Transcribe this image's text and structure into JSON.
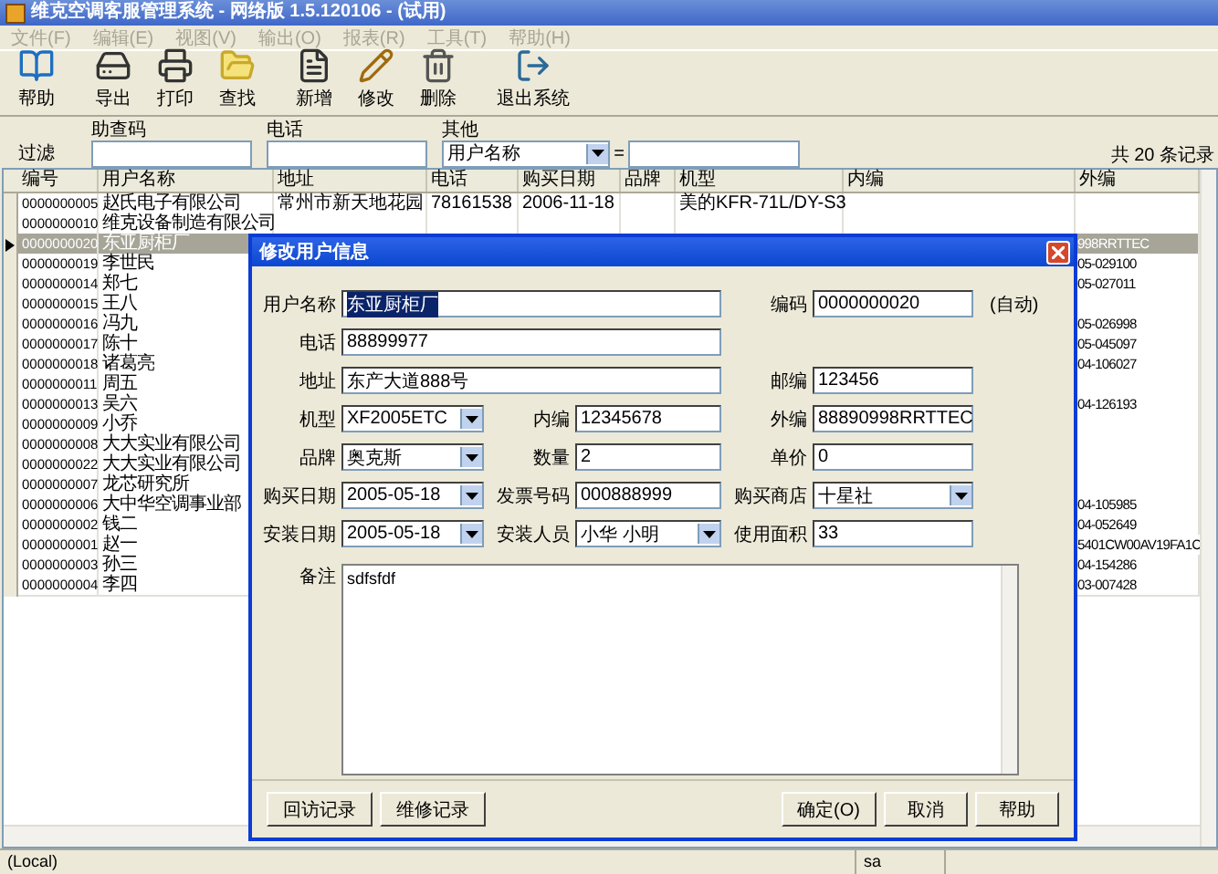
{
  "window": {
    "title": "维克空调客服管理系统 - 网络版 1.5.120106 - (试用)"
  },
  "menu": [
    "文件(F)",
    "编辑(E)",
    "视图(V)",
    "输出(O)",
    "报表(R)",
    "工具(T)",
    "帮助(H)"
  ],
  "toolbar": [
    {
      "label": "帮助",
      "kind": "help"
    },
    {
      "label": "导出",
      "kind": "export"
    },
    {
      "label": "打印",
      "kind": "print"
    },
    {
      "label": "查找",
      "kind": "find"
    },
    {
      "label": "新增",
      "kind": "new"
    },
    {
      "label": "修改",
      "kind": "edit"
    },
    {
      "label": "删除",
      "kind": "delete"
    },
    {
      "label": "退出系统",
      "kind": "exit"
    }
  ],
  "filter": {
    "label": "过滤",
    "fields": [
      {
        "label": "助查码",
        "kind": "text"
      },
      {
        "label": "电话",
        "kind": "text"
      },
      {
        "label": "其他",
        "kind": "select",
        "value": "用户名称"
      }
    ],
    "operator": "="
  },
  "record_count": "共 20 条记录",
  "table": {
    "columns": [
      "编号",
      "用户名称",
      "地址",
      "电话",
      "购买日期",
      "品牌",
      "机型",
      "内编",
      "外编"
    ],
    "rows": [
      {
        "id": "0000000005",
        "name": "赵氏电子有限公司",
        "address": "常州市新天地花园",
        "phone": "78161538",
        "date": "2006-11-18",
        "model": "美的KFR-71L/DY-S3",
        "selected": false
      },
      {
        "id": "0000000010",
        "name": "维克设备制造有限公司",
        "selected": false
      },
      {
        "id": "0000000020",
        "name": "东亚厨柜厂",
        "outer": "998RRTTEC",
        "selected": true
      },
      {
        "id": "0000000019",
        "name": "李世民",
        "outer": "05-029100",
        "selected": false
      },
      {
        "id": "0000000014",
        "name": "郑七",
        "outer": "05-027011",
        "selected": false
      },
      {
        "id": "0000000015",
        "name": "王八",
        "selected": false
      },
      {
        "id": "0000000016",
        "name": "冯九",
        "outer": "05-026998",
        "selected": false
      },
      {
        "id": "0000000017",
        "name": "陈十",
        "outer": "05-045097",
        "selected": false
      },
      {
        "id": "0000000018",
        "name": "诸葛亮",
        "outer": "04-106027",
        "selected": false
      },
      {
        "id": "0000000011",
        "name": "周五",
        "selected": false
      },
      {
        "id": "0000000013",
        "name": "吴六",
        "outer": "04-126193",
        "selected": false
      },
      {
        "id": "0000000009",
        "name": "小乔",
        "selected": false
      },
      {
        "id": "0000000008",
        "name": "大大实业有限公司",
        "selected": false
      },
      {
        "id": "0000000022",
        "name": "大大实业有限公司",
        "selected": false
      },
      {
        "id": "0000000007",
        "name": "龙芯研究所",
        "selected": false
      },
      {
        "id": "0000000006",
        "name": "大中华空调事业部",
        "outer": "04-105985",
        "selected": false
      },
      {
        "id": "0000000002",
        "name": "钱二",
        "outer": "04-052649",
        "selected": false
      },
      {
        "id": "0000000001",
        "name": "赵一",
        "outer": "5401CW00AV19FA1C",
        "selected": false
      },
      {
        "id": "0000000003",
        "name": "孙三",
        "outer": "04-154286",
        "selected": false
      },
      {
        "id": "0000000004",
        "name": "李四",
        "outer": "03-007428",
        "selected": false
      }
    ]
  },
  "status_bar": [
    "(Local)",
    "sa"
  ],
  "dialog": {
    "title": "修改用户信息",
    "rows": [
      [
        {
          "label": "用户名称",
          "value": "东亚厨柜厂",
          "kind": "wide",
          "focused": true
        },
        {
          "label": "编码",
          "value": "0000000020",
          "kind": "text",
          "focused": false,
          "note": "(自动)"
        }
      ],
      [
        {
          "label": "电话",
          "value": "88899977",
          "kind": "wide",
          "focused": false
        }
      ],
      [
        {
          "label": "地址",
          "value": "东产大道888号",
          "kind": "wide",
          "focused": false
        },
        {
          "label": "邮编",
          "value": "123456",
          "kind": "text",
          "focused": false
        }
      ],
      [
        {
          "label": "机型",
          "value": "XF2005ETC",
          "kind": "select",
          "focused": false
        },
        {
          "label": "内编",
          "value": "12345678",
          "kind": "text",
          "focused": false
        },
        {
          "label": "外编",
          "value": "88890998RRTTEC",
          "kind": "text",
          "focused": false
        }
      ],
      [
        {
          "label": "品牌",
          "value": "奥克斯",
          "kind": "select",
          "focused": false
        },
        {
          "label": "数量",
          "value": "2",
          "kind": "text",
          "focused": false
        },
        {
          "label": "单价",
          "value": "0",
          "kind": "text",
          "focused": false
        }
      ],
      [
        {
          "label": "购买日期",
          "value": "2005-05-18",
          "kind": "select",
          "focused": false
        },
        {
          "label": "发票号码",
          "value": "000888999",
          "kind": "text",
          "focused": false
        },
        {
          "label": "购买商店",
          "value": "十星社",
          "kind": "select",
          "focused": false
        }
      ],
      [
        {
          "label": "安装日期",
          "value": "2005-05-18",
          "kind": "select",
          "focused": false
        },
        {
          "label": "安装人员",
          "value": "小华 小明",
          "kind": "select",
          "focused": false
        },
        {
          "label": "使用面积",
          "value": "33",
          "kind": "text",
          "focused": false
        }
      ]
    ],
    "notes": {
      "label": "备注",
      "value": "sdfsfdf"
    },
    "left_buttons": [
      "回访记录",
      "维修记录"
    ],
    "right_buttons": [
      "确定(O)",
      "取消",
      "帮助"
    ]
  }
}
